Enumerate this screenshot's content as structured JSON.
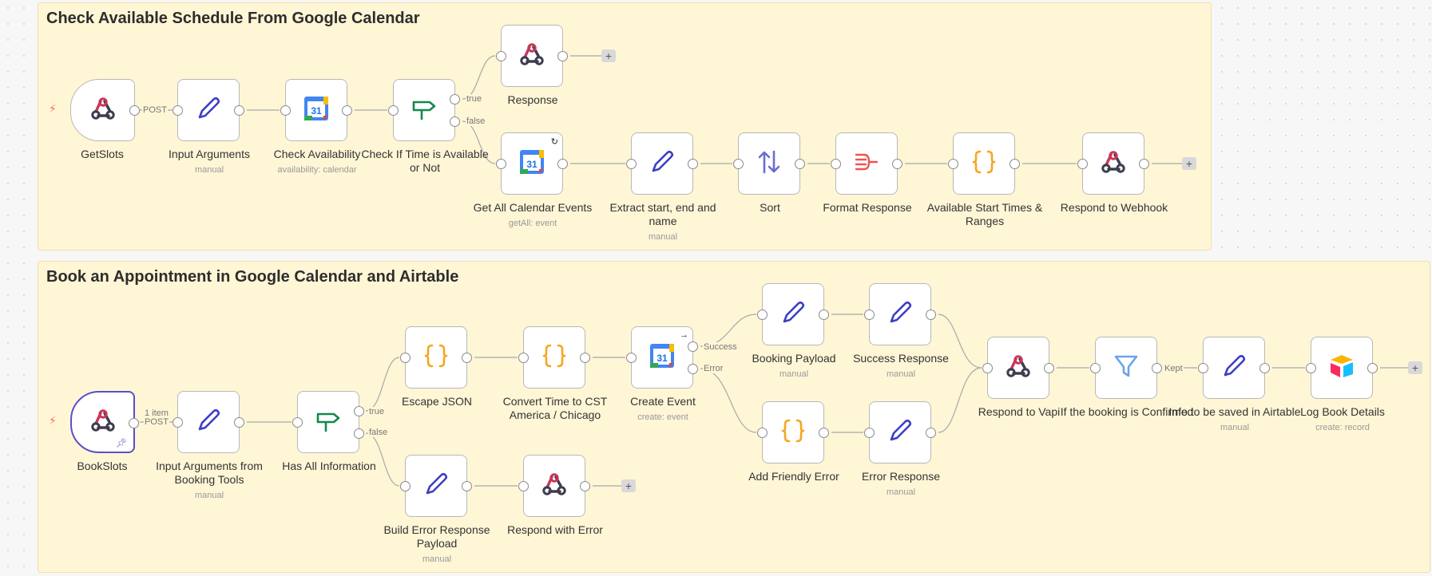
{
  "stickies": {
    "schedule": {
      "title": "Check Available Schedule From Google Calendar"
    },
    "book": {
      "title": "Book an Appointment in Google Calendar and Airtable"
    }
  },
  "edge_labels": {
    "post1": "POST",
    "post2": "POST",
    "one_item": "1 item",
    "true1": "true",
    "false1": "false",
    "true2": "true",
    "false2": "false",
    "success": "Success",
    "error": "Error",
    "kept": "Kept"
  },
  "nodes": {
    "getslots": {
      "label": "GetSlots",
      "sub": "",
      "icon": "webhook-icon"
    },
    "input_args": {
      "label": "Input Arguments",
      "sub": "manual",
      "icon": "pencil-icon"
    },
    "check_avail": {
      "label": "Check Availability",
      "sub": "availability: calendar",
      "icon": "google-calendar-icon"
    },
    "check_if_time": {
      "label": "Check If Time is Available or Not",
      "sub": "",
      "icon": "if-signpost-icon"
    },
    "response": {
      "label": "Response",
      "sub": "",
      "icon": "webhook-icon"
    },
    "get_all_events": {
      "label": "Get All Calendar Events",
      "sub": "getAll: event",
      "icon": "google-calendar-icon"
    },
    "extract": {
      "label": "Extract start, end and name",
      "sub": "manual",
      "icon": "pencil-icon"
    },
    "sort": {
      "label": "Sort",
      "sub": "",
      "icon": "sort-arrows-icon"
    },
    "format_response": {
      "label": "Format Response",
      "sub": "",
      "icon": "aggregate-icon"
    },
    "available_start": {
      "label": "Available Start Times & Ranges",
      "sub": "",
      "icon": "code-braces-icon"
    },
    "respond_webhook": {
      "label": "Respond to Webhook",
      "sub": "",
      "icon": "webhook-icon"
    },
    "bookslots": {
      "label": "BookSlots",
      "sub": "",
      "icon": "webhook-icon"
    },
    "input_args_booking": {
      "label": "Input Arguments from Booking Tools",
      "sub": "manual",
      "icon": "pencil-icon"
    },
    "has_all_info": {
      "label": "Has All Information",
      "sub": "",
      "icon": "if-signpost-icon"
    },
    "escape_json": {
      "label": "Escape JSON",
      "sub": "",
      "icon": "code-braces-icon"
    },
    "convert_time": {
      "label": "Convert Time to CST America / Chicago",
      "sub": "",
      "icon": "code-braces-icon"
    },
    "create_event": {
      "label": "Create Event",
      "sub": "create: event",
      "icon": "google-calendar-icon"
    },
    "booking_payload": {
      "label": "Booking Payload",
      "sub": "manual",
      "icon": "pencil-icon"
    },
    "success_response": {
      "label": "Success Response",
      "sub": "manual",
      "icon": "pencil-icon"
    },
    "add_friendly_error": {
      "label": "Add Friendly Error",
      "sub": "",
      "icon": "code-braces-icon"
    },
    "error_response": {
      "label": "Error Response",
      "sub": "manual",
      "icon": "pencil-icon"
    },
    "build_error": {
      "label": "Build Error Response Payload",
      "sub": "manual",
      "icon": "pencil-icon"
    },
    "respond_error": {
      "label": "Respond with Error",
      "sub": "",
      "icon": "webhook-icon"
    },
    "respond_vapi": {
      "label": "Respond to Vapi",
      "sub": "",
      "icon": "webhook-icon"
    },
    "if_confirmed": {
      "label": "If the booking is Confirmed",
      "sub": "",
      "icon": "filter-icon"
    },
    "info_airtable": {
      "label": "Info to be saved in Airtable",
      "sub": "manual",
      "icon": "pencil-icon"
    },
    "log_book": {
      "label": "Log Book Details",
      "sub": "create: record",
      "icon": "airtable-icon"
    }
  },
  "calendar_day": "31",
  "plus_symbol": "+",
  "colors": {
    "sticky_bg": "#fff6d6",
    "trigger_bolt": "#ff6d5a",
    "pencil": "#3e3ec5",
    "code": "#f5a623",
    "if": "#14884a",
    "sort": "#6b6bd6",
    "aggregate": "#ef5350",
    "filter": "#6aa4e8",
    "selected": "#5a50c6"
  }
}
